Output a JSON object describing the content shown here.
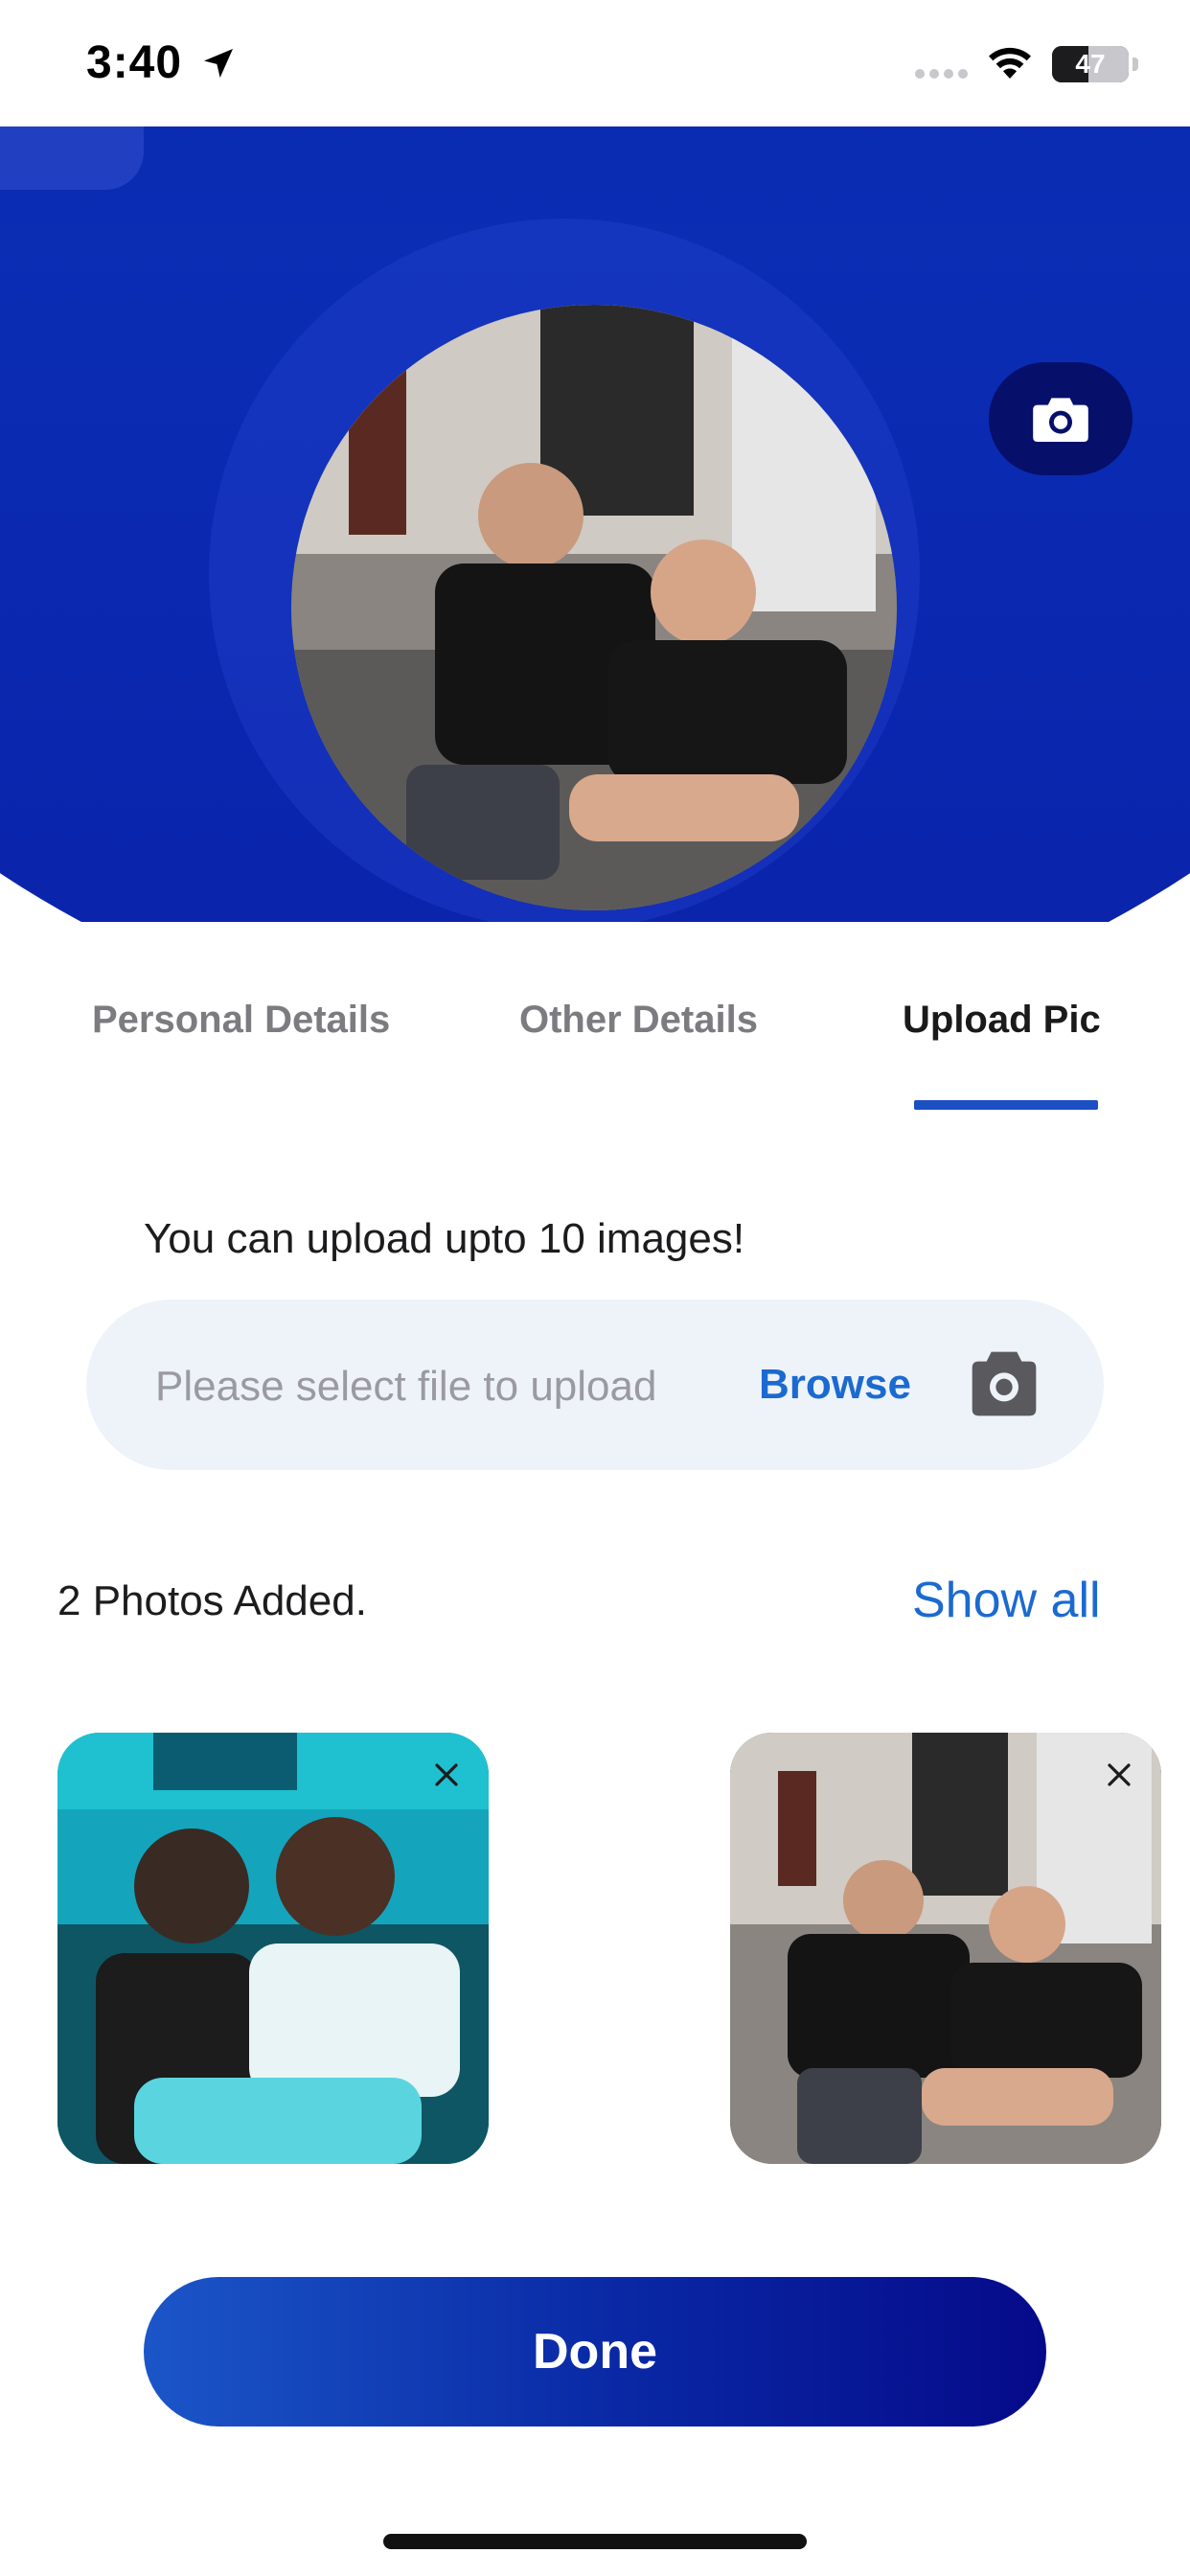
{
  "status_bar": {
    "time": "3:40",
    "battery": "47"
  },
  "profile": {
    "camera_icon": "camera-icon"
  },
  "tabs": [
    {
      "label": "Personal Details",
      "active": false
    },
    {
      "label": "Other Details",
      "active": false
    },
    {
      "label": "Upload Pic",
      "active": true
    }
  ],
  "upload": {
    "hint": "You can upload upto 10 images!",
    "placeholder": "Please select file to upload",
    "browse_label": "Browse"
  },
  "photos": {
    "count_label": "2 Photos Added.",
    "show_all_label": "Show all"
  },
  "done_label": "Done",
  "colors": {
    "brand_blue": "#0a2db4",
    "link_blue": "#1b6ad0",
    "tab_indicator": "#1b4fc4"
  }
}
